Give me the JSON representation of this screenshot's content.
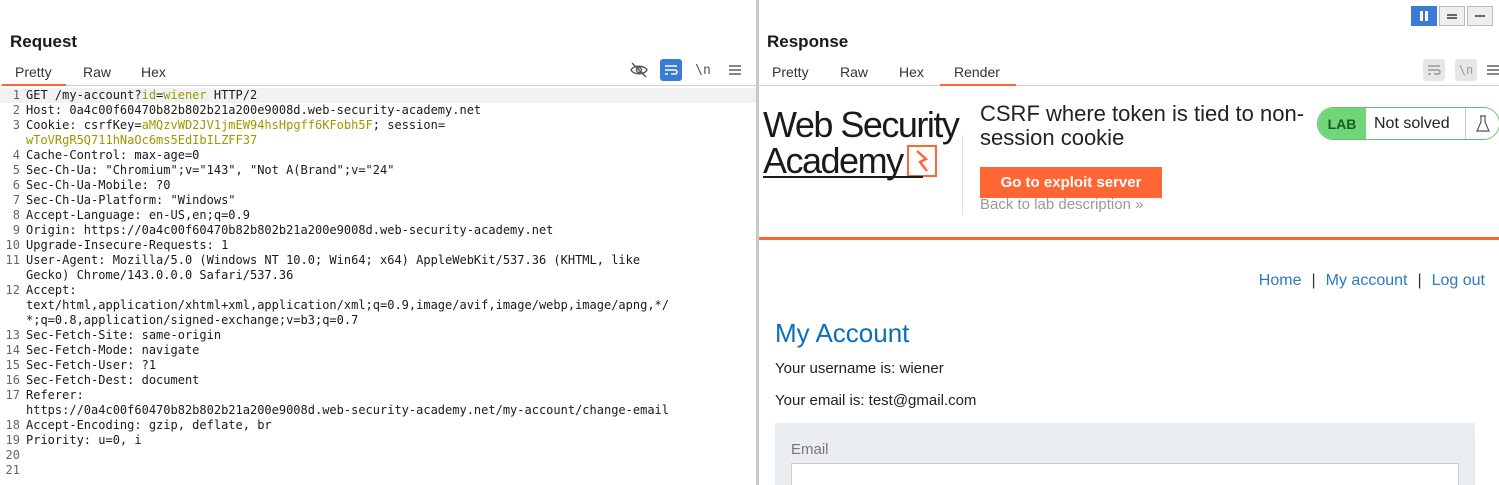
{
  "request": {
    "title": "Request",
    "tabs": [
      "Pretty",
      "Raw",
      "Hex"
    ],
    "tool_newline": "\\n",
    "lines": [
      {
        "n": "1",
        "parts": [
          [
            "k",
            "GET /my-account?"
          ],
          [
            "p",
            "id"
          ],
          [
            "k",
            "="
          ],
          [
            "p",
            "wiener"
          ],
          [
            "k",
            " HTTP/2"
          ]
        ]
      },
      {
        "n": "2",
        "parts": [
          [
            "k",
            "Host: 0a4c00f60470b82b802b21a200e9008d.web-security-academy.net"
          ]
        ]
      },
      {
        "n": "3",
        "parts": [
          [
            "k",
            "Cookie: "
          ],
          [
            "k",
            "csrfKey"
          ],
          [
            "k",
            "="
          ],
          [
            "p",
            "aMQzvWD2JV1jmEW94hsHpgff6KFobh5F"
          ],
          [
            "k",
            "; "
          ],
          [
            "k",
            "session"
          ],
          [
            "k",
            "="
          ]
        ]
      },
      {
        "n": "",
        "parts": [
          [
            "p",
            "wToVRgR5Q711hNaOc6ms5EdIbILZFF37"
          ]
        ]
      },
      {
        "n": "4",
        "parts": [
          [
            "k",
            "Cache-Control: max-age=0"
          ]
        ]
      },
      {
        "n": "5",
        "parts": [
          [
            "k",
            "Sec-Ch-Ua: \"Chromium\";v=\"143\", \"Not A(Brand\";v=\"24\""
          ]
        ]
      },
      {
        "n": "6",
        "parts": [
          [
            "k",
            "Sec-Ch-Ua-Mobile: ?0"
          ]
        ]
      },
      {
        "n": "7",
        "parts": [
          [
            "k",
            "Sec-Ch-Ua-Platform: \"Windows\""
          ]
        ]
      },
      {
        "n": "8",
        "parts": [
          [
            "k",
            "Accept-Language: en-US,en;q=0.9"
          ]
        ]
      },
      {
        "n": "9",
        "parts": [
          [
            "k",
            "Origin: https://0a4c00f60470b82b802b21a200e9008d.web-security-academy.net"
          ]
        ]
      },
      {
        "n": "10",
        "parts": [
          [
            "k",
            "Upgrade-Insecure-Requests: 1"
          ]
        ]
      },
      {
        "n": "11",
        "parts": [
          [
            "k",
            "User-Agent: Mozilla/5.0 (Windows NT 10.0; Win64; x64) AppleWebKit/537.36 (KHTML, like"
          ]
        ]
      },
      {
        "n": "",
        "parts": [
          [
            "k",
            "Gecko) Chrome/143.0.0.0 Safari/537.36"
          ]
        ]
      },
      {
        "n": "12",
        "parts": [
          [
            "k",
            "Accept:"
          ]
        ]
      },
      {
        "n": "",
        "parts": [
          [
            "k",
            "text/html,application/xhtml+xml,application/xml;q=0.9,image/avif,image/webp,image/apng,*/"
          ]
        ]
      },
      {
        "n": "",
        "parts": [
          [
            "k",
            "*;q=0.8,application/signed-exchange;v=b3;q=0.7"
          ]
        ]
      },
      {
        "n": "13",
        "parts": [
          [
            "k",
            "Sec-Fetch-Site: same-origin"
          ]
        ]
      },
      {
        "n": "14",
        "parts": [
          [
            "k",
            "Sec-Fetch-Mode: navigate"
          ]
        ]
      },
      {
        "n": "15",
        "parts": [
          [
            "k",
            "Sec-Fetch-User: ?1"
          ]
        ]
      },
      {
        "n": "16",
        "parts": [
          [
            "k",
            "Sec-Fetch-Dest: document"
          ]
        ]
      },
      {
        "n": "17",
        "parts": [
          [
            "k",
            "Referer:"
          ]
        ]
      },
      {
        "n": "",
        "parts": [
          [
            "k",
            "https://0a4c00f60470b82b802b21a200e9008d.web-security-academy.net/my-account/change-email"
          ]
        ]
      },
      {
        "n": "18",
        "parts": [
          [
            "k",
            "Accept-Encoding: gzip, deflate, br"
          ]
        ]
      },
      {
        "n": "19",
        "parts": [
          [
            "k",
            "Priority: u=0, i"
          ]
        ]
      },
      {
        "n": "20",
        "parts": []
      },
      {
        "n": "21",
        "parts": []
      }
    ]
  },
  "response": {
    "title": "Response",
    "tabs": [
      "Pretty",
      "Raw",
      "Hex",
      "Render"
    ],
    "tool_newline": "\\n",
    "render": {
      "logo_line1": "Web Security",
      "logo_line2": "Academy",
      "lab_title": "CSRF where token is tied to non-session cookie",
      "exploit_button": "Go to exploit server",
      "back_link": "Back to lab description",
      "back_chevron": "»",
      "lab_tag": "LAB",
      "lab_status": "Not solved",
      "nav": {
        "home": "Home",
        "sep": "|",
        "account": "My account",
        "logout": "Log out"
      },
      "heading": "My Account",
      "username_line": "Your username is: wiener",
      "email_line": "Your email is: test@gmail.com",
      "email_label": "Email"
    }
  },
  "colors": {
    "accent": "#ff6633",
    "param": "#9a9a00",
    "link": "#2a7ac7",
    "lab_green": "#70d679",
    "tool_active": "#3a7bd5"
  }
}
